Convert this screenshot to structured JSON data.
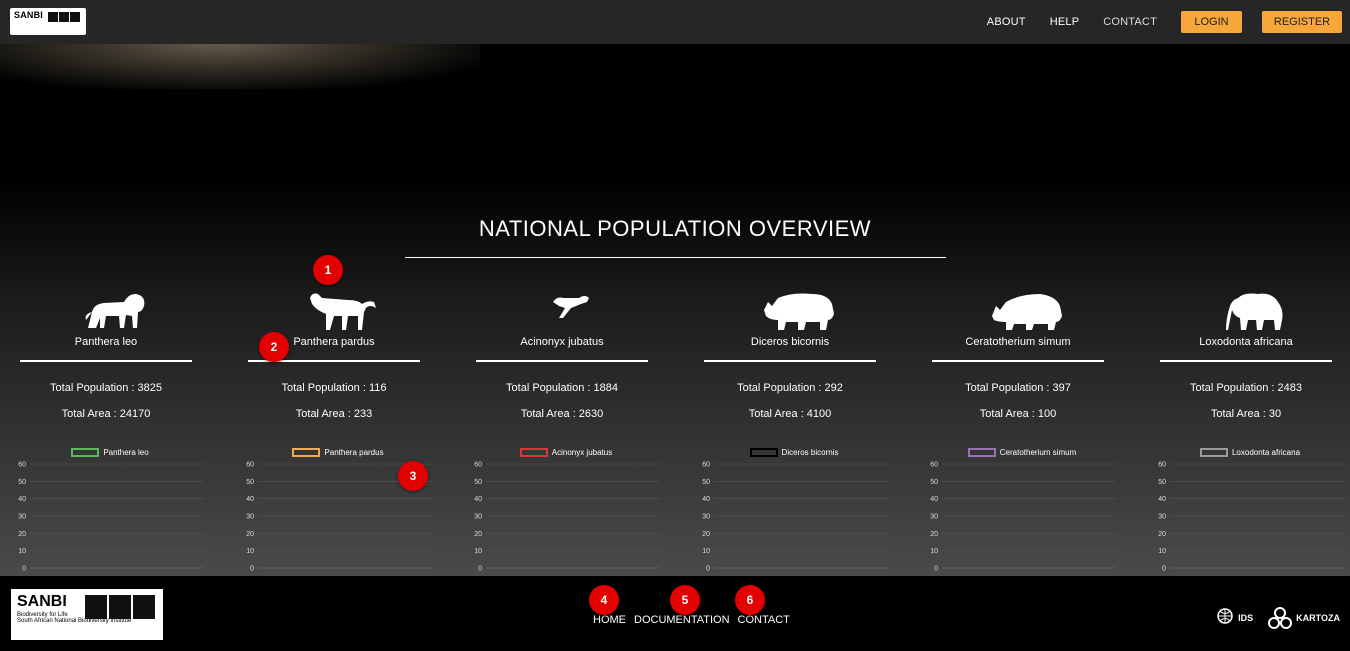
{
  "header": {
    "logo": {
      "brand": "SANBI"
    },
    "nav": [
      "ABOUT",
      "HELP",
      "CONTACT"
    ],
    "login_label": "LOGIN",
    "register_label": "REGISTER"
  },
  "overview": {
    "title": "NATIONAL POPULATION OVERVIEW",
    "species": [
      {
        "name": "Panthera leo",
        "population": "Total Population : 3825",
        "area": "Total Area : 24170",
        "legend_color": "#5cb85c",
        "icon": "lion-icon"
      },
      {
        "name": "Panthera pardus",
        "population": "Total Population : 116",
        "area": "Total Area : 233",
        "legend_color": "#f0ad4e",
        "icon": "leopard-icon"
      },
      {
        "name": "Acinonyx jubatus",
        "population": "Total Population : 1884",
        "area": "Total Area : 2630",
        "legend_color": "#d9383a",
        "icon": "cheetah-icon"
      },
      {
        "name": "Diceros bicornis",
        "population": "Total Population : 292",
        "area": "Total Area : 4100",
        "legend_color": "#000000",
        "icon": "black-rhino-icon"
      },
      {
        "name": "Ceratotherium simum",
        "population": "Total Population : 397",
        "area": "Total Area : 100",
        "legend_color": "#9b72b0",
        "icon": "white-rhino-icon"
      },
      {
        "name": "Loxodonta africana",
        "population": "Total Population : 2483",
        "area": "Total Area : 30",
        "legend_color": "#9a9a9a",
        "icon": "elephant-icon"
      }
    ],
    "chart_ticks": [
      "60",
      "50",
      "40",
      "30",
      "20",
      "10",
      "0"
    ]
  },
  "footer": {
    "logo": {
      "brand": "SANBI",
      "line1": "Biodiversity for Life",
      "line2": "South African National Biodiversity Institute"
    },
    "links": [
      "HOME",
      "DOCUMENTATION",
      "CONTACT"
    ],
    "partners": [
      "IDS",
      "KARTOZA"
    ]
  },
  "markers": [
    "1",
    "2",
    "3",
    "4",
    "5",
    "6"
  ],
  "chart_data": [
    {
      "type": "bar",
      "series": [
        {
          "name": "Panthera leo",
          "values": []
        }
      ],
      "ylim": [
        0,
        60
      ]
    },
    {
      "type": "bar",
      "series": [
        {
          "name": "Panthera pardus",
          "values": []
        }
      ],
      "ylim": [
        0,
        60
      ]
    },
    {
      "type": "bar",
      "series": [
        {
          "name": "Acinonyx jubatus",
          "values": []
        }
      ],
      "ylim": [
        0,
        60
      ]
    },
    {
      "type": "bar",
      "series": [
        {
          "name": "Diceros bicornis",
          "values": []
        }
      ],
      "ylim": [
        0,
        60
      ]
    },
    {
      "type": "bar",
      "series": [
        {
          "name": "Ceratotherium simum",
          "values": []
        }
      ],
      "ylim": [
        0,
        60
      ]
    },
    {
      "type": "bar",
      "series": [
        {
          "name": "Loxodonta africana",
          "values": []
        }
      ],
      "ylim": [
        0,
        60
      ]
    }
  ]
}
